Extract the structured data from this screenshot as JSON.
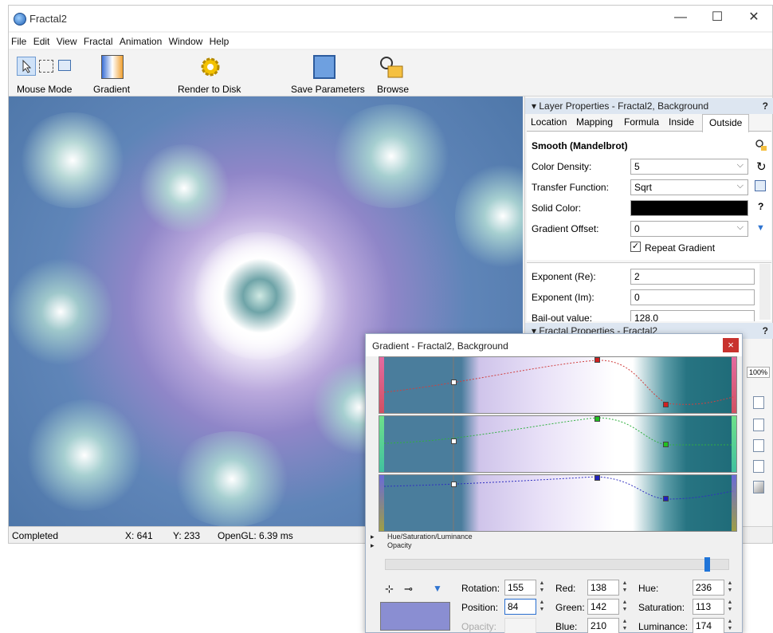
{
  "window": {
    "title": "Fractal2",
    "minimize": "—",
    "maximize": "☐",
    "close": "✕"
  },
  "menu": [
    "File",
    "Edit",
    "View",
    "Fractal",
    "Animation",
    "Window",
    "Help"
  ],
  "toolbar": {
    "mouse_mode": "Mouse Mode",
    "gradient": "Gradient",
    "render": "Render to Disk",
    "save": "Save Parameters",
    "browse": "Browse"
  },
  "status": {
    "state": "Completed",
    "x": "X: 641",
    "y": "Y: 233",
    "opengl": "OpenGL: 6.39 ms"
  },
  "layer_panel": {
    "title": "Layer Properties - Fractal2, Background",
    "help": "?",
    "tabs": [
      "Location",
      "Mapping",
      "Formula",
      "Inside",
      "Outside"
    ],
    "active_tab": "Outside",
    "section": "Smooth (Mandelbrot)",
    "color_density_label": "Color Density:",
    "color_density": "5",
    "transfer_label": "Transfer Function:",
    "transfer": "Sqrt",
    "solid_label": "Solid Color:",
    "solid_color": "#000000",
    "offset_label": "Gradient Offset:",
    "offset": "0",
    "repeat_label": "Repeat Gradient",
    "repeat_checked": true,
    "exp_re_label": "Exponent (Re):",
    "exp_re": "2",
    "exp_im_label": "Exponent (Im):",
    "exp_im": "0",
    "bailout_label": "Bail-out value:",
    "bailout": "128.0"
  },
  "fractal_panel": {
    "title": "Fractal Properties - Fractal2",
    "help": "?",
    "zoom": "100%"
  },
  "gradient_window": {
    "title": "Gradient - Fractal2, Background",
    "close": "×",
    "hsl_label": "Hue/Saturation/Luminance",
    "opacity_label": "Opacity",
    "rotation_label": "Rotation:",
    "rotation": "155",
    "position_label": "Position:",
    "position": "84",
    "opacity_field_label": "Opacity:",
    "red_label": "Red:",
    "red": "138",
    "green_label": "Green:",
    "green": "142",
    "blue_label": "Blue:",
    "blue": "210",
    "hue_label": "Hue:",
    "hue": "236",
    "saturation_label": "Saturation:",
    "saturation": "113",
    "luminance_label": "Luminance:",
    "luminance": "174",
    "swatch_color": "#8a8ed2"
  }
}
